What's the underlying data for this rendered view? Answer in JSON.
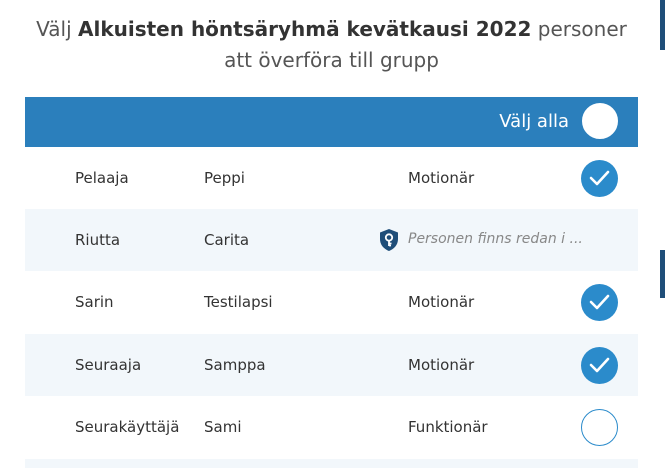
{
  "dialog": {
    "title_prefix": "Välj ",
    "group_name": "Alkuisten höntsäryhmä kevätkausi 2022",
    "title_suffix": " personer att överföra till grupp"
  },
  "header": {
    "select_all_label": "Välj alla",
    "select_all_checked": false
  },
  "colors": {
    "accent": "#2b7fbc",
    "check": "#2b8bcb",
    "row_alt": "#f2f7fb"
  },
  "rows": [
    {
      "last_name": "Pelaaja",
      "first_name": "Peppi",
      "role": "Motionär",
      "checked": true
    },
    {
      "last_name": "Riutta",
      "first_name": "Carita",
      "notice": "Personen finns redan i ...",
      "notice_icon": "shield-key-icon"
    },
    {
      "last_name": "Sarin",
      "first_name": "Testilapsi",
      "role": "Motionär",
      "checked": true
    },
    {
      "last_name": "Seuraaja",
      "first_name": "Samppa",
      "role": "Motionär",
      "checked": true
    },
    {
      "last_name": "Seurakäyttäjä",
      "first_name": "Sami",
      "role": "Funktionär",
      "checked": false
    }
  ]
}
